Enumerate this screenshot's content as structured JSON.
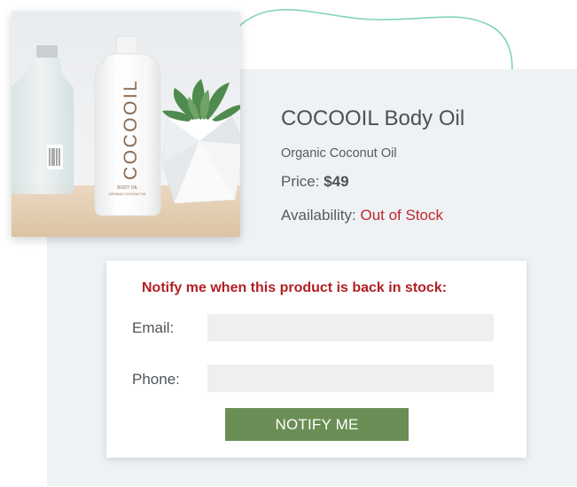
{
  "product": {
    "image_alt_icon": "product-photo",
    "title": "COCOOIL Body Oil",
    "subtitle": "Organic Coconut Oil",
    "price_label": "Price:",
    "price_value": "$49",
    "availability_label": "Availability:",
    "availability_value": "Out of Stock",
    "bottle_brand": "COCOOIL",
    "bottle_line1": "BODY OIL",
    "bottle_line2": "ORGANIC COCONUT OIL"
  },
  "notify": {
    "heading": "Notify me when this product is back in stock:",
    "email_label": "Email:",
    "email_value": "",
    "phone_label": "Phone:",
    "phone_value": "",
    "button_label": "NOTIFY ME"
  },
  "colors": {
    "accent_red": "#c1272d",
    "button_green": "#6a8e55",
    "panel_bg": "#eef2f5",
    "squiggle": "#7fd3b6"
  }
}
